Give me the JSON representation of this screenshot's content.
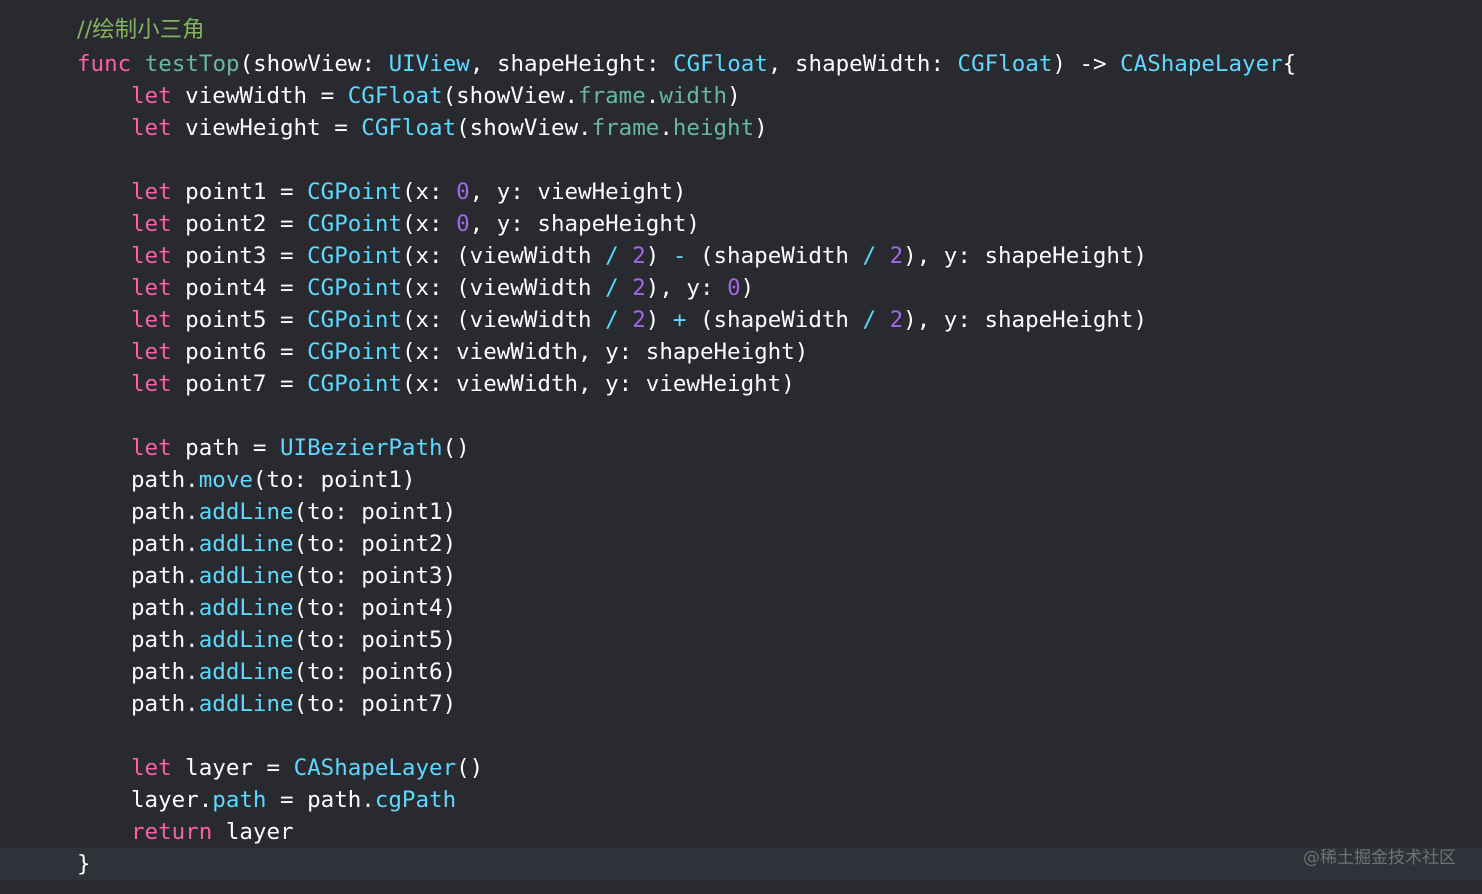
{
  "theme": {
    "background": "#292a30",
    "current_line_background": "#2f3239",
    "keyword": "#fc5fa3",
    "type": "#5dd8ff",
    "member": "#67b7a4",
    "number": "#a167e6",
    "comment": "#84b360",
    "plain": "#ffffff"
  },
  "code": {
    "lines": [
      {
        "indent": 0,
        "tokens": [
          {
            "t": "//绘制小三角",
            "c": "comment-zh"
          }
        ]
      },
      {
        "indent": 0,
        "tokens": [
          {
            "t": "func",
            "c": "kw"
          },
          {
            "t": " ",
            "c": "plain"
          },
          {
            "t": "testTop",
            "c": "fn"
          },
          {
            "t": "(showView: ",
            "c": "plain"
          },
          {
            "t": "UIView",
            "c": "type"
          },
          {
            "t": ", shapeHeight: ",
            "c": "plain"
          },
          {
            "t": "CGFloat",
            "c": "type"
          },
          {
            "t": ", shapeWidth: ",
            "c": "plain"
          },
          {
            "t": "CGFloat",
            "c": "type"
          },
          {
            "t": ") -> ",
            "c": "plain"
          },
          {
            "t": "CAShapeLayer",
            "c": "type"
          },
          {
            "t": "{",
            "c": "plain"
          }
        ]
      },
      {
        "indent": 1,
        "tokens": [
          {
            "t": "let",
            "c": "kw"
          },
          {
            "t": " viewWidth = ",
            "c": "plain"
          },
          {
            "t": "CGFloat",
            "c": "type"
          },
          {
            "t": "(showView.",
            "c": "plain"
          },
          {
            "t": "frame",
            "c": "member"
          },
          {
            "t": ".",
            "c": "plain"
          },
          {
            "t": "width",
            "c": "member"
          },
          {
            "t": ")",
            "c": "plain"
          }
        ]
      },
      {
        "indent": 1,
        "tokens": [
          {
            "t": "let",
            "c": "kw"
          },
          {
            "t": " viewHeight = ",
            "c": "plain"
          },
          {
            "t": "CGFloat",
            "c": "type"
          },
          {
            "t": "(showView.",
            "c": "plain"
          },
          {
            "t": "frame",
            "c": "member"
          },
          {
            "t": ".",
            "c": "plain"
          },
          {
            "t": "height",
            "c": "member"
          },
          {
            "t": ")",
            "c": "plain"
          }
        ]
      },
      {
        "indent": 1,
        "tokens": []
      },
      {
        "indent": 1,
        "tokens": [
          {
            "t": "let",
            "c": "kw"
          },
          {
            "t": " point1 = ",
            "c": "plain"
          },
          {
            "t": "CGPoint",
            "c": "type"
          },
          {
            "t": "(x: ",
            "c": "plain"
          },
          {
            "t": "0",
            "c": "neutral"
          },
          {
            "t": ", y: viewHeight)",
            "c": "plain"
          }
        ]
      },
      {
        "indent": 1,
        "tokens": [
          {
            "t": "let",
            "c": "kw"
          },
          {
            "t": " point2 = ",
            "c": "plain"
          },
          {
            "t": "CGPoint",
            "c": "type"
          },
          {
            "t": "(x: ",
            "c": "plain"
          },
          {
            "t": "0",
            "c": "neutral"
          },
          {
            "t": ", y: shapeHeight)",
            "c": "plain"
          }
        ]
      },
      {
        "indent": 1,
        "tokens": [
          {
            "t": "let",
            "c": "kw"
          },
          {
            "t": " point3 = ",
            "c": "plain"
          },
          {
            "t": "CGPoint",
            "c": "type"
          },
          {
            "t": "(x: (viewWidth ",
            "c": "plain"
          },
          {
            "t": "/",
            "c": "type"
          },
          {
            "t": " ",
            "c": "plain"
          },
          {
            "t": "2",
            "c": "neutral"
          },
          {
            "t": ") ",
            "c": "plain"
          },
          {
            "t": "-",
            "c": "type"
          },
          {
            "t": " (shapeWidth ",
            "c": "plain"
          },
          {
            "t": "/",
            "c": "type"
          },
          {
            "t": " ",
            "c": "plain"
          },
          {
            "t": "2",
            "c": "neutral"
          },
          {
            "t": "), y: shapeHeight)",
            "c": "plain"
          }
        ]
      },
      {
        "indent": 1,
        "tokens": [
          {
            "t": "let",
            "c": "kw"
          },
          {
            "t": " point4 = ",
            "c": "plain"
          },
          {
            "t": "CGPoint",
            "c": "type"
          },
          {
            "t": "(x: (viewWidth ",
            "c": "plain"
          },
          {
            "t": "/",
            "c": "type"
          },
          {
            "t": " ",
            "c": "plain"
          },
          {
            "t": "2",
            "c": "neutral"
          },
          {
            "t": "), y: ",
            "c": "plain"
          },
          {
            "t": "0",
            "c": "neutral"
          },
          {
            "t": ")",
            "c": "plain"
          }
        ]
      },
      {
        "indent": 1,
        "tokens": [
          {
            "t": "let",
            "c": "kw"
          },
          {
            "t": " point5 = ",
            "c": "plain"
          },
          {
            "t": "CGPoint",
            "c": "type"
          },
          {
            "t": "(x: (viewWidth ",
            "c": "plain"
          },
          {
            "t": "/",
            "c": "type"
          },
          {
            "t": " ",
            "c": "plain"
          },
          {
            "t": "2",
            "c": "neutral"
          },
          {
            "t": ") ",
            "c": "plain"
          },
          {
            "t": "+",
            "c": "type"
          },
          {
            "t": " (shapeWidth ",
            "c": "plain"
          },
          {
            "t": "/",
            "c": "type"
          },
          {
            "t": " ",
            "c": "plain"
          },
          {
            "t": "2",
            "c": "neutral"
          },
          {
            "t": "), y: shapeHeight)",
            "c": "plain"
          }
        ]
      },
      {
        "indent": 1,
        "tokens": [
          {
            "t": "let",
            "c": "kw"
          },
          {
            "t": " point6 = ",
            "c": "plain"
          },
          {
            "t": "CGPoint",
            "c": "type"
          },
          {
            "t": "(x: viewWidth, y: shapeHeight)",
            "c": "plain"
          }
        ]
      },
      {
        "indent": 1,
        "tokens": [
          {
            "t": "let",
            "c": "kw"
          },
          {
            "t": " point7 = ",
            "c": "plain"
          },
          {
            "t": "CGPoint",
            "c": "type"
          },
          {
            "t": "(x: viewWidth, y: viewHeight)",
            "c": "plain"
          }
        ]
      },
      {
        "indent": 1,
        "tokens": []
      },
      {
        "indent": 1,
        "tokens": [
          {
            "t": "let",
            "c": "kw"
          },
          {
            "t": " path = ",
            "c": "plain"
          },
          {
            "t": "UIBezierPath",
            "c": "type"
          },
          {
            "t": "()",
            "c": "plain"
          }
        ]
      },
      {
        "indent": 1,
        "tokens": [
          {
            "t": "path.",
            "c": "plain"
          },
          {
            "t": "move",
            "c": "type"
          },
          {
            "t": "(to: point1)",
            "c": "plain"
          }
        ]
      },
      {
        "indent": 1,
        "tokens": [
          {
            "t": "path.",
            "c": "plain"
          },
          {
            "t": "addLine",
            "c": "type"
          },
          {
            "t": "(to: point1)",
            "c": "plain"
          }
        ]
      },
      {
        "indent": 1,
        "tokens": [
          {
            "t": "path.",
            "c": "plain"
          },
          {
            "t": "addLine",
            "c": "type"
          },
          {
            "t": "(to: point2)",
            "c": "plain"
          }
        ]
      },
      {
        "indent": 1,
        "tokens": [
          {
            "t": "path.",
            "c": "plain"
          },
          {
            "t": "addLine",
            "c": "type"
          },
          {
            "t": "(to: point3)",
            "c": "plain"
          }
        ]
      },
      {
        "indent": 1,
        "tokens": [
          {
            "t": "path.",
            "c": "plain"
          },
          {
            "t": "addLine",
            "c": "type"
          },
          {
            "t": "(to: point4)",
            "c": "plain"
          }
        ]
      },
      {
        "indent": 1,
        "tokens": [
          {
            "t": "path.",
            "c": "plain"
          },
          {
            "t": "addLine",
            "c": "type"
          },
          {
            "t": "(to: point5)",
            "c": "plain"
          }
        ]
      },
      {
        "indent": 1,
        "tokens": [
          {
            "t": "path.",
            "c": "plain"
          },
          {
            "t": "addLine",
            "c": "type"
          },
          {
            "t": "(to: point6)",
            "c": "plain"
          }
        ]
      },
      {
        "indent": 1,
        "tokens": [
          {
            "t": "path.",
            "c": "plain"
          },
          {
            "t": "addLine",
            "c": "type"
          },
          {
            "t": "(to: point7)",
            "c": "plain"
          }
        ]
      },
      {
        "indent": 1,
        "tokens": []
      },
      {
        "indent": 1,
        "tokens": [
          {
            "t": "let",
            "c": "kw"
          },
          {
            "t": " layer = ",
            "c": "plain"
          },
          {
            "t": "CAShapeLayer",
            "c": "type"
          },
          {
            "t": "()",
            "c": "plain"
          }
        ]
      },
      {
        "indent": 1,
        "tokens": [
          {
            "t": "layer.",
            "c": "plain"
          },
          {
            "t": "path",
            "c": "type"
          },
          {
            "t": " = path.",
            "c": "plain"
          },
          {
            "t": "cgPath",
            "c": "type"
          }
        ]
      },
      {
        "indent": 1,
        "tokens": [
          {
            "t": "return",
            "c": "kw"
          },
          {
            "t": " layer",
            "c": "plain"
          }
        ]
      },
      {
        "indent": 0,
        "current": true,
        "tokens": [
          {
            "t": "}",
            "c": "plain"
          }
        ]
      }
    ]
  },
  "watermark": {
    "text": "@稀土掘金技术社区"
  }
}
